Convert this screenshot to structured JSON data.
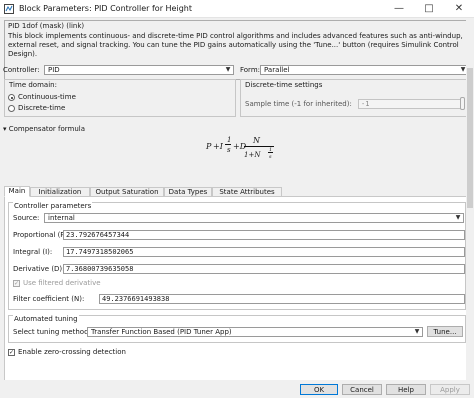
{
  "window": {
    "title": "Block Parameters: PID Controller for Height",
    "minimize": "—",
    "maximize": "□",
    "close": "✕"
  },
  "header": {
    "block_type": "PID 1dof (mask) (link)",
    "description": "This block implements continuous- and discrete-time PID control algorithms and includes advanced features such as anti-windup, external reset, and signal tracking. You can tune the PID gains automatically using the 'Tune...' button (requires Simulink Control Design)."
  },
  "controller": {
    "label": "Controller:",
    "value": "PID"
  },
  "form": {
    "label": "Form:",
    "value": "Parallel"
  },
  "time_domain": {
    "label": "Time domain:",
    "options": [
      "Continuous-time",
      "Discrete-time"
    ],
    "selected": "Continuous-time"
  },
  "discrete_settings": {
    "label": "Discrete-time settings",
    "sample_time_label": "Sample time (-1 for inherited):",
    "sample_time_value": "-1"
  },
  "compensator": {
    "label": "Compensator formula",
    "formula": {
      "p": "P",
      "plus_i": "+I",
      "one_a": "1",
      "s_a": "s",
      "plus_d": "+D",
      "n_num": "N",
      "den_pre": "1+N",
      "one_b": "1",
      "s_b": "s"
    }
  },
  "tabs": [
    "Main",
    "Initialization",
    "Output Saturation",
    "Data Types",
    "State Attributes"
  ],
  "active_tab": "Main",
  "controller_parameters": {
    "label": "Controller parameters",
    "source_label": "Source:",
    "source_value": "internal",
    "proportional_label": "Proportional (P):",
    "proportional_value": "23.792676457344",
    "integral_label": "Integral (I):",
    "integral_value": "17.7497318502065",
    "derivative_label": "Derivative (D):",
    "derivative_value": "7.36800739635058",
    "use_filtered_label": "Use filtered derivative",
    "use_filtered_checked": true,
    "filter_coef_label": "Filter coefficient (N):",
    "filter_coef_value": "49.2376691493838"
  },
  "automated_tuning": {
    "label": "Automated tuning",
    "method_label": "Select tuning method:",
    "method_value": "Transfer Function Based (PID Tuner App)",
    "tune_button": "Tune..."
  },
  "zero_crossing": {
    "label": "Enable zero-crossing detection",
    "checked": true
  },
  "footer": {
    "ok": "OK",
    "cancel": "Cancel",
    "help": "Help",
    "apply": "Apply"
  }
}
